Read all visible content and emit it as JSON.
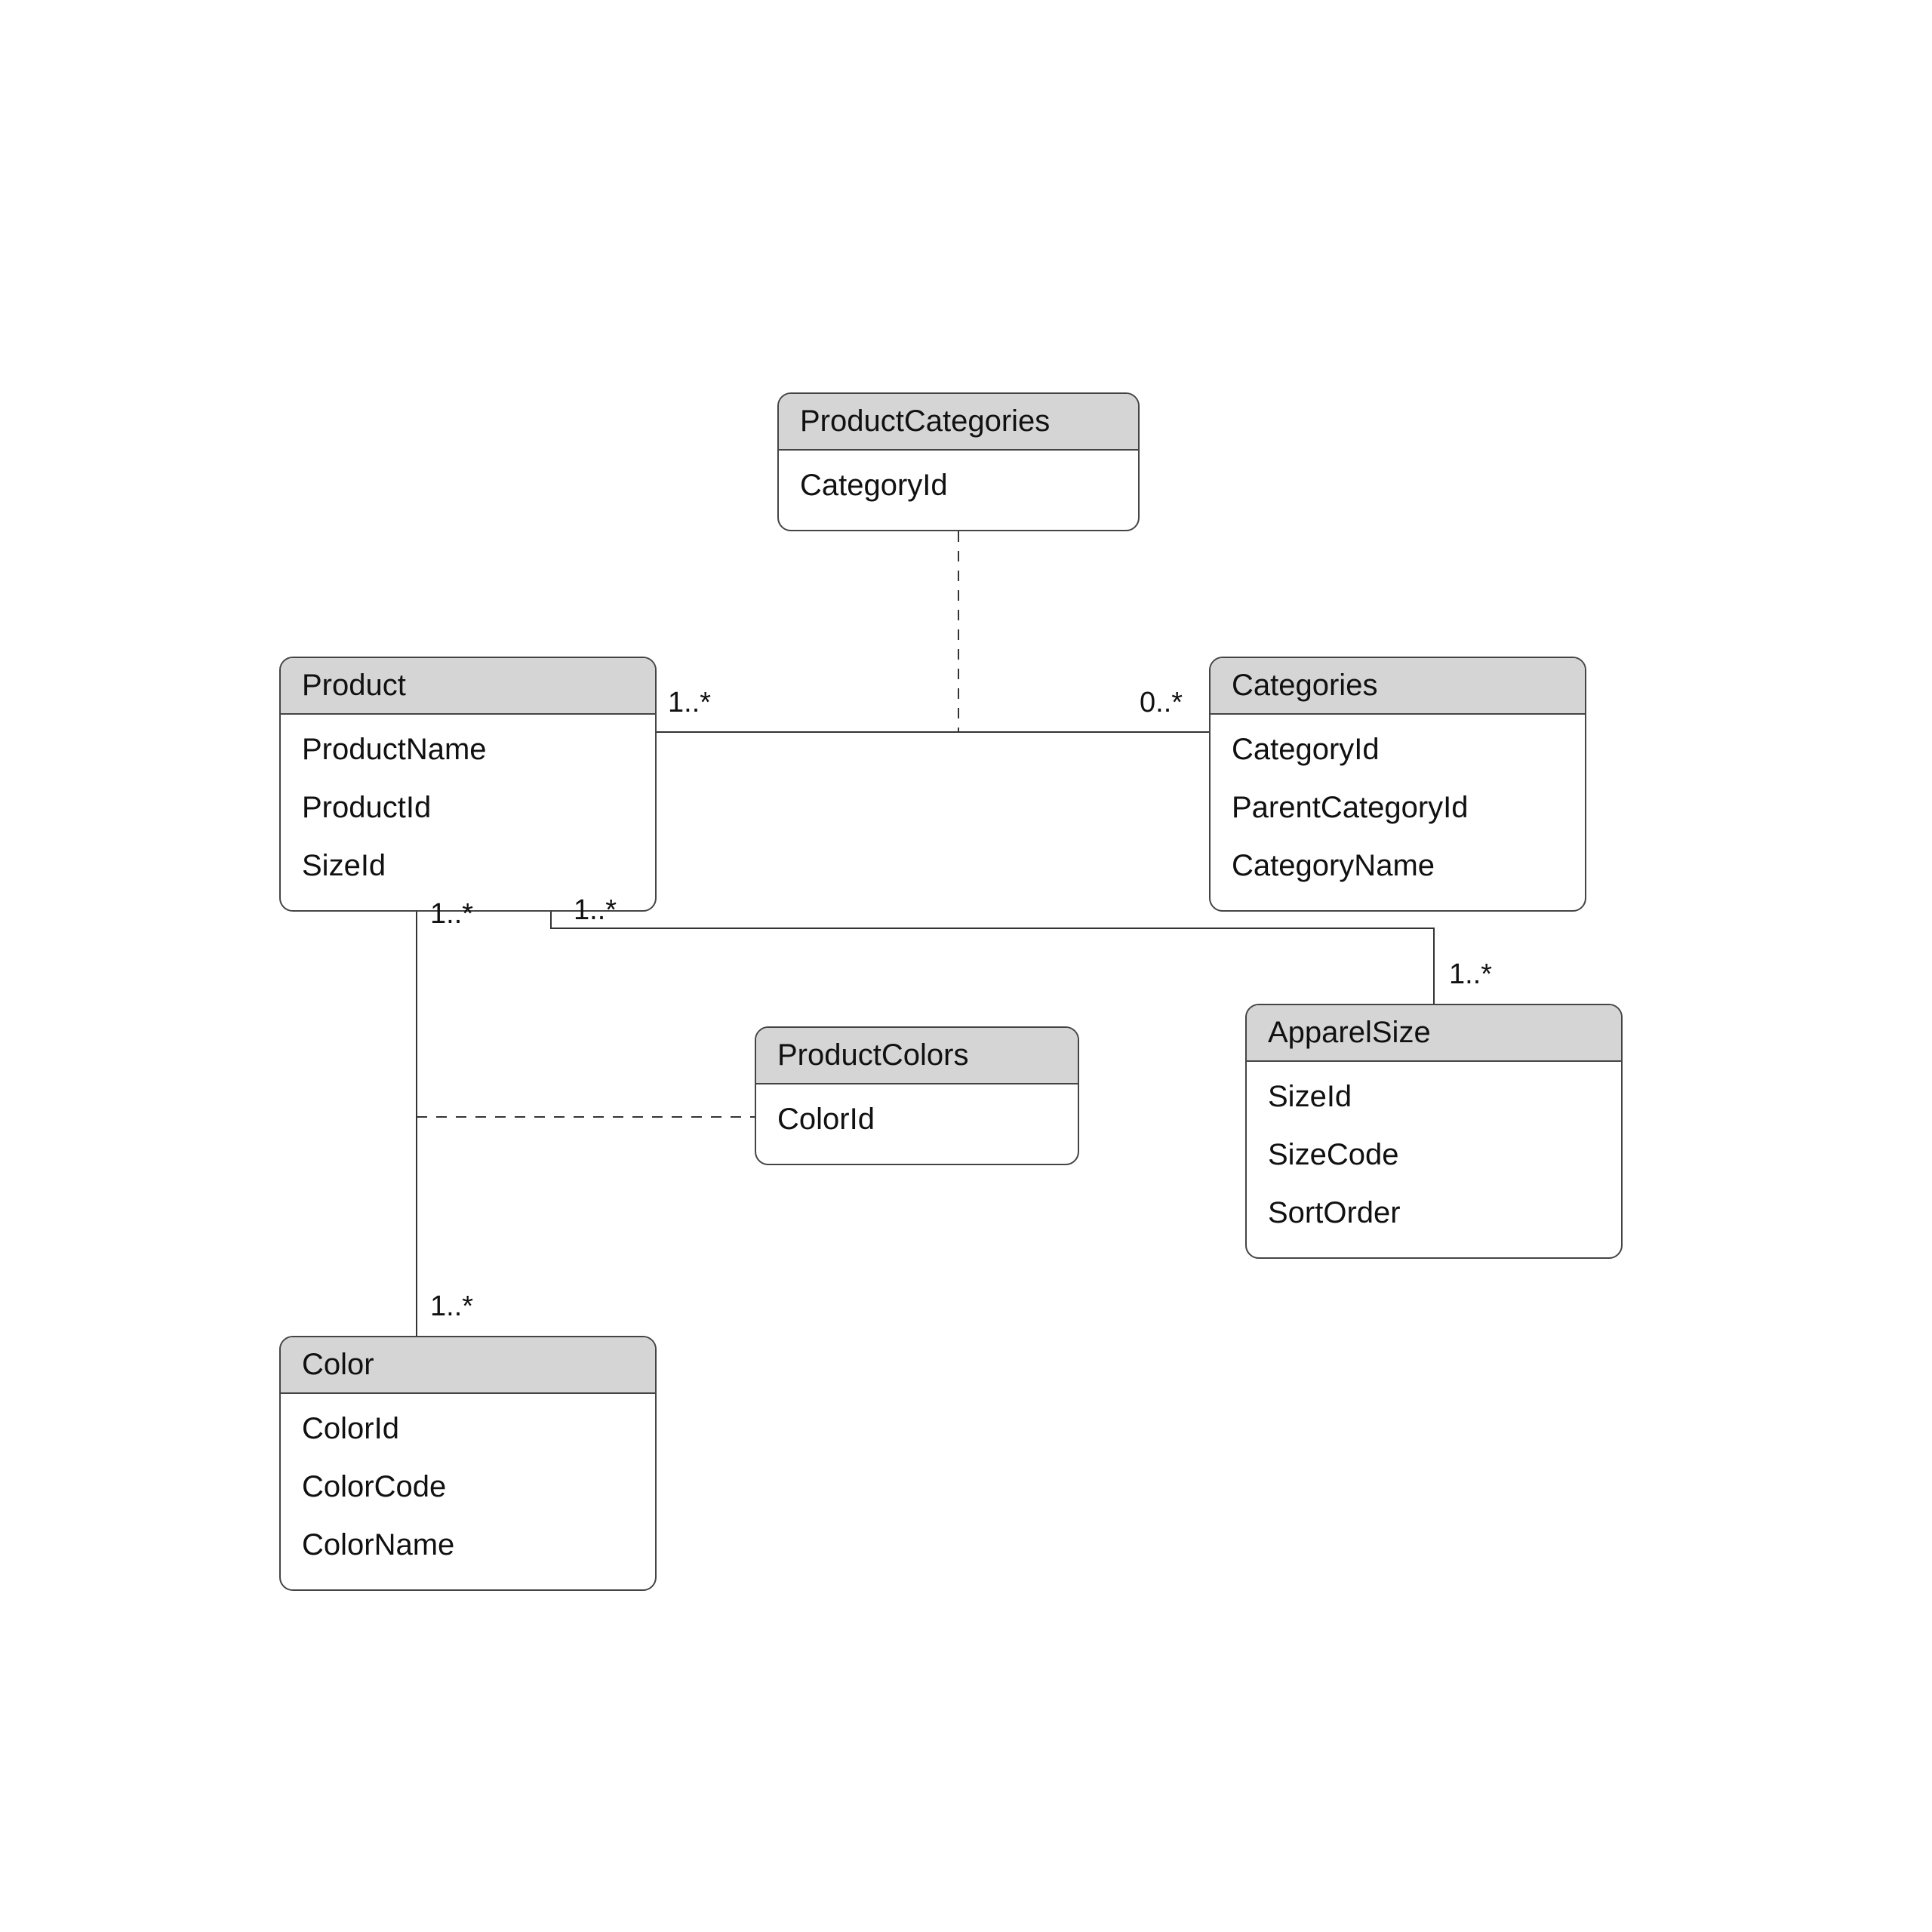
{
  "entities": {
    "productCategories": {
      "title": "ProductCategories",
      "attrs": [
        "CategoryId"
      ]
    },
    "product": {
      "title": "Product",
      "attrs": [
        "ProductName",
        "ProductId",
        "SizeId"
      ]
    },
    "categories": {
      "title": "Categories",
      "attrs": [
        "CategoryId",
        "ParentCategoryId",
        "CategoryName"
      ]
    },
    "productColors": {
      "title": "ProductColors",
      "attrs": [
        "ColorId"
      ]
    },
    "apparelSize": {
      "title": "ApparelSize",
      "attrs": [
        "SizeId",
        "SizeCode",
        "SortOrder"
      ]
    },
    "color": {
      "title": "Color",
      "attrs": [
        "ColorId",
        "ColorCode",
        "ColorName"
      ]
    }
  },
  "multiplicities": {
    "prod_cat_left": "1..*",
    "prod_cat_right": "0..*",
    "prod_color_top": "1..*",
    "prod_color_bottom": "1..*",
    "prod_size_left": "1..*",
    "prod_size_right": "1..*"
  }
}
